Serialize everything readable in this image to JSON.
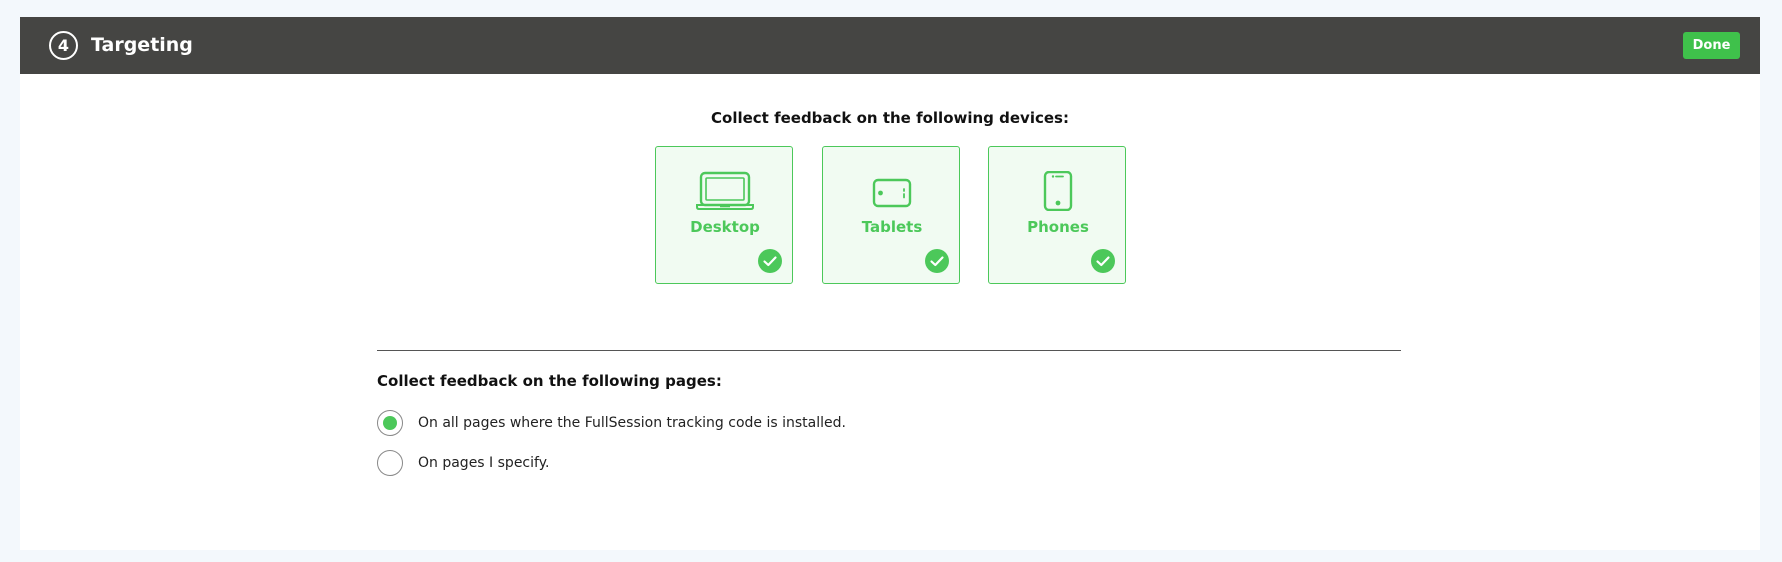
{
  "header": {
    "step_number": "4",
    "title": "Targeting",
    "done_label": "Done"
  },
  "devices": {
    "heading": "Collect feedback on the following devices:",
    "items": [
      {
        "label": "Desktop",
        "icon": "laptop-icon",
        "selected": true
      },
      {
        "label": "Tablets",
        "icon": "tablet-icon",
        "selected": true
      },
      {
        "label": "Phones",
        "icon": "phone-icon",
        "selected": true
      }
    ]
  },
  "pages": {
    "heading": "Collect feedback on the following pages:",
    "options": [
      {
        "label": "On all pages where the FullSession tracking code is installed.",
        "selected": true
      },
      {
        "label": "On pages I specify.",
        "selected": false
      }
    ]
  },
  "colors": {
    "accent": "#4cc85a",
    "header_bg": "#454543",
    "done_bg": "#3fc14b"
  }
}
